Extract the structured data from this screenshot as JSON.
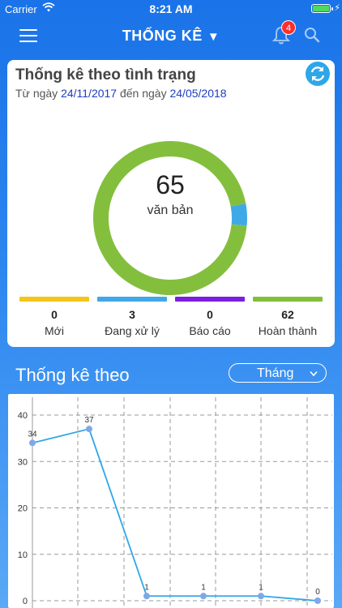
{
  "status_bar": {
    "carrier": "Carrier",
    "time": "8:21 AM"
  },
  "header": {
    "title": "THỐNG KÊ",
    "notification_count": "4"
  },
  "summary": {
    "title": "Thống kê theo tình trạng",
    "date_prefix": "Từ ngày",
    "date_from": "24/11/2017",
    "date_mid": "đến ngày",
    "date_to": "24/05/2018",
    "total": "65",
    "unit": "văn bản",
    "legend": [
      {
        "label": "Mới",
        "count": "0",
        "color": "#f5c518"
      },
      {
        "label": "Đang xử lý",
        "count": "3",
        "color": "#3fa9e8"
      },
      {
        "label": "Báo cáo",
        "count": "0",
        "color": "#7d1ee0"
      },
      {
        "label": "Hoàn thành",
        "count": "62",
        "color": "#83bf3d"
      }
    ]
  },
  "trend": {
    "title": "Thống kê theo",
    "period": "Tháng"
  },
  "chart_data": [
    {
      "type": "pie",
      "labels": [
        "Mới",
        "Đang xử lý",
        "Báo cáo",
        "Hoàn thành"
      ],
      "values": [
        0,
        3,
        0,
        62
      ],
      "colors": [
        "#f5c518",
        "#3fa9e8",
        "#7d1ee0",
        "#83bf3d"
      ],
      "center_text": "65"
    },
    {
      "type": "line",
      "x": [
        1,
        2,
        3,
        4,
        5,
        6
      ],
      "values": [
        34,
        37,
        1,
        1,
        1,
        0
      ],
      "data_labels": [
        "34",
        "37",
        "1",
        "1",
        "1",
        "0"
      ],
      "y_ticks": [
        "40",
        "30",
        "20",
        "10",
        "0"
      ],
      "ylim": [
        0,
        40
      ],
      "grid": true,
      "color": "#2ea7e8"
    }
  ]
}
